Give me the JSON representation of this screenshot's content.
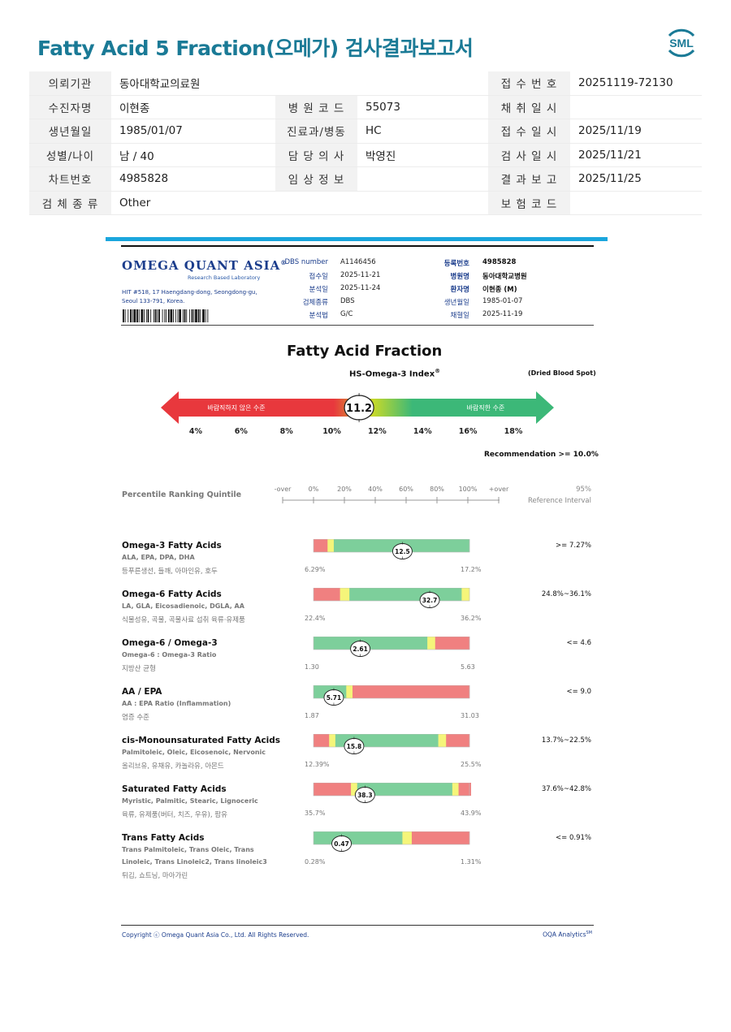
{
  "header": {
    "title": "Fatty Acid 5 Fraction(오메가) 검사결과보고서",
    "logo_text": "SML"
  },
  "info_rows": [
    [
      {
        "label": "의뢰기관",
        "value": "동아대학교의료원"
      },
      {
        "label": "",
        "value": ""
      },
      {
        "label": "접 수 번 호",
        "value": "20251119-72130"
      }
    ],
    [
      {
        "label": "수진자명",
        "value": "이현종"
      },
      {
        "label": "병 원 코 드",
        "value": "55073"
      },
      {
        "label": "채 취 일 시",
        "value": ""
      }
    ],
    [
      {
        "label": "생년월일",
        "value": "1985/01/07"
      },
      {
        "label": "진료과/병동",
        "value": "HC"
      },
      {
        "label": "접 수 일 시",
        "value": "2025/11/19"
      }
    ],
    [
      {
        "label": "성별/나이",
        "value": "남 / 40"
      },
      {
        "label": "담 당 의 사",
        "value": "박영진"
      },
      {
        "label": "검 사 일 시",
        "value": "2025/11/21"
      }
    ],
    [
      {
        "label": "차트번호",
        "value": "4985828"
      },
      {
        "label": "임 상 정 보",
        "value": ""
      },
      {
        "label": "결 과 보 고",
        "value": "2025/11/25"
      }
    ],
    [
      {
        "label": "검 체 종 류",
        "value": "Other"
      },
      {
        "label": "",
        "value": ""
      },
      {
        "label": "보 험 코 드",
        "value": ""
      }
    ]
  ],
  "lab": {
    "name": "OMEGA QUANT ASIA",
    "reg": "®",
    "subtitle": "Research Based Laboratory",
    "address1": "HIT #518, 17 Haengdang-dong, Seongdong-gu,",
    "address2": "Seoul 133-791, Korea."
  },
  "meta_left": [
    {
      "label": "DBS number",
      "value": "A1146456"
    },
    {
      "label": "접수일",
      "value": "2025-11-21"
    },
    {
      "label": "분석일",
      "value": "2025-11-24"
    },
    {
      "label": "검체종류",
      "value": "DBS"
    },
    {
      "label": "분석법",
      "value": "G/C"
    }
  ],
  "meta_right": [
    {
      "label": "등록번호",
      "value": "4985828"
    },
    {
      "label": "병원명",
      "value": "동아대학교병원"
    },
    {
      "label": "환자명",
      "value": "이현종 (M)"
    },
    {
      "label": "생년월일",
      "value": "1985-01-07"
    },
    {
      "label": "채혈일",
      "value": "2025-11-19"
    }
  ],
  "index": {
    "title": "Fatty Acid Fraction",
    "subtitle": "HS-Omega-3 Index",
    "subtitle_mark": "®",
    "specimen_note": "(Dried Blood Spot)",
    "value": 11.2,
    "value_label": "11.2",
    "bad_label": "바람직하지 않은 수준",
    "good_label": "바람직한 수준",
    "ticks": [
      "4%",
      "6%",
      "8%",
      "10%",
      "12%",
      "14%",
      "16%",
      "18%"
    ],
    "tick_values": [
      4,
      6,
      8,
      10,
      12,
      14,
      16,
      18
    ],
    "recommendation": "Recommendation  >= 10.0%",
    "colors": {
      "bad": "#e8383d",
      "mid": "#c7d92a",
      "good": "#3cb878"
    }
  },
  "percentile": {
    "title": "Percentile Ranking Quintile",
    "labels": [
      "-over",
      "0%",
      "20%",
      "40%",
      "60%",
      "80%",
      "100%",
      "+over"
    ],
    "ref_top": "95%",
    "ref_bottom": "Reference Interval"
  },
  "rows": [
    {
      "name": "Omega-3 Fatty Acids",
      "sub": "ALA, EPA, DPA, DHA",
      "sub2": "",
      "kor": "등푸른생선, 들깨, 아마인유, 호두",
      "min": "6.29%",
      "max": "17.2%",
      "value": 12.5,
      "value_label": "12.5",
      "ref": ">= 7.27%",
      "segments": [
        {
          "c": "red",
          "w": 0.09
        },
        {
          "c": "yellow",
          "w": 0.04
        },
        {
          "c": "green",
          "w": 0.87
        }
      ],
      "pos": 0.57
    },
    {
      "name": "Omega-6 Fatty Acids",
      "sub": "LA, GLA, Eicosadienoic, DGLA, AA",
      "sub2": "",
      "kor": "식물성유, 곡물, 곡물사료 섭취 육류·유제품",
      "min": "22.4%",
      "max": "36.2%",
      "value": 32.7,
      "value_label": "32.7",
      "ref": "24.8%~36.1%",
      "segments": [
        {
          "c": "red",
          "w": 0.17
        },
        {
          "c": "yellow",
          "w": 0.06
        },
        {
          "c": "green",
          "w": 0.72
        },
        {
          "c": "yellow",
          "w": 0.05
        }
      ],
      "pos": 0.745
    },
    {
      "name": "Omega-6 / Omega-3",
      "sub": "Omega-6 : Omega-3 Ratio",
      "sub2": "",
      "kor": "지방산 균형",
      "min": "1.30",
      "max": "5.63",
      "value": 2.61,
      "value_label": "2.61",
      "ref": "<= 4.6",
      "segments": [
        {
          "c": "green",
          "w": 0.73
        },
        {
          "c": "yellow",
          "w": 0.05
        },
        {
          "c": "red",
          "w": 0.22
        }
      ],
      "pos": 0.3
    },
    {
      "name": "AA / EPA",
      "sub": "AA : EPA Ratio (Inflammation)",
      "sub2": "",
      "kor": "염증 수준",
      "min": "1.87",
      "max": "31.03",
      "value": 5.71,
      "value_label": "5.71",
      "ref": "<= 9.0",
      "segments": [
        {
          "c": "green",
          "w": 0.21
        },
        {
          "c": "yellow",
          "w": 0.04
        },
        {
          "c": "red",
          "w": 0.75
        }
      ],
      "pos": 0.13
    },
    {
      "name": "cis-Monounsaturated Fatty Acids",
      "sub": "Palmitoleic, Oleic, Eicosenoic, Nervonic",
      "sub2": "",
      "kor": "올리브유, 유채유, 카놀라유, 아몬드",
      "min": "12.39%",
      "max": "25.5%",
      "value": 15.8,
      "value_label": "15.8",
      "ref": "13.7%~22.5%",
      "segments": [
        {
          "c": "red",
          "w": 0.1
        },
        {
          "c": "yellow",
          "w": 0.04
        },
        {
          "c": "green",
          "w": 0.66
        },
        {
          "c": "yellow",
          "w": 0.05
        },
        {
          "c": "red",
          "w": 0.15
        }
      ],
      "pos": 0.26
    },
    {
      "name": "Saturated Fatty Acids",
      "sub": "Myristic, Palmitic, Stearic, Lignoceric",
      "sub2": "",
      "kor": "육류, 유제품(버터, 치즈, 우유), 팜유",
      "min": "35.7%",
      "max": "43.9%",
      "value": 38.3,
      "value_label": "38.3",
      "ref": "37.6%~42.8%",
      "segments": [
        {
          "c": "red",
          "w": 0.24
        },
        {
          "c": "yellow",
          "w": 0.04
        },
        {
          "c": "green",
          "w": 0.61
        },
        {
          "c": "yellow",
          "w": 0.04
        },
        {
          "c": "red",
          "w": 0.11
        }
      ],
      "pos": 0.33
    },
    {
      "name": "Trans Fatty Acids",
      "sub": "Trans Palmitoleic, Trans Oleic, Trans",
      "sub2": "Linoleic, Trans Linoleic2, Trans linoleic3",
      "kor": "튀김, 쇼트닝, 마아가린",
      "min": "0.28%",
      "max": "1.31%",
      "value": 0.47,
      "value_label": "0.47",
      "ref": "<= 0.91%",
      "segments": [
        {
          "c": "green",
          "w": 0.57
        },
        {
          "c": "yellow",
          "w": 0.06
        },
        {
          "c": "red",
          "w": 0.37
        }
      ],
      "pos": 0.18
    }
  ],
  "row_colors": {
    "red": "#f08080",
    "yellow": "#f5f57a",
    "green": "#7dcf9b"
  },
  "footer": {
    "copyright": "Copyright ⓒ Omega Quant Asia Co., Ltd.  All Rights Reserved.",
    "analytics": "OQA Analytics",
    "analytics_mark": "SM"
  }
}
